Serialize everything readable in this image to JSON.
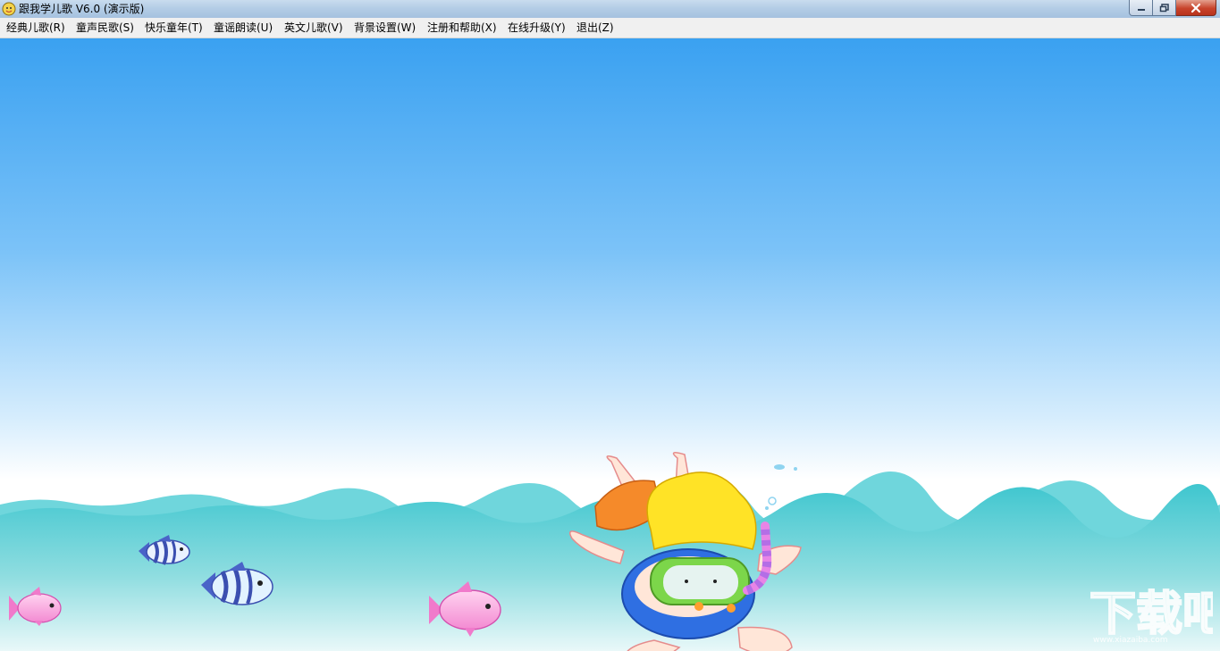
{
  "window": {
    "title": "跟我学儿歌 V6.0 (演示版)",
    "icons": {
      "app": "app-icon",
      "minimize": "minimize-icon",
      "maximize": "maximize-icon",
      "close": "close-icon"
    }
  },
  "menu": {
    "items": [
      {
        "label": "经典儿歌(R)"
      },
      {
        "label": "童声民歌(S)"
      },
      {
        "label": "快乐童年(T)"
      },
      {
        "label": "童谣朗读(U)"
      },
      {
        "label": "英文儿歌(V)"
      },
      {
        "label": "背景设置(W)"
      },
      {
        "label": "注册和帮助(X)"
      },
      {
        "label": "在线升级(Y)"
      },
      {
        "label": "退出(Z)"
      }
    ]
  },
  "scene": {
    "sky_top_color": "#3aa1f1",
    "sky_bottom_color": "#ffffff",
    "water_color": "#3fc6cf",
    "watermark": "下载吧 www.xiazaiba.com"
  }
}
